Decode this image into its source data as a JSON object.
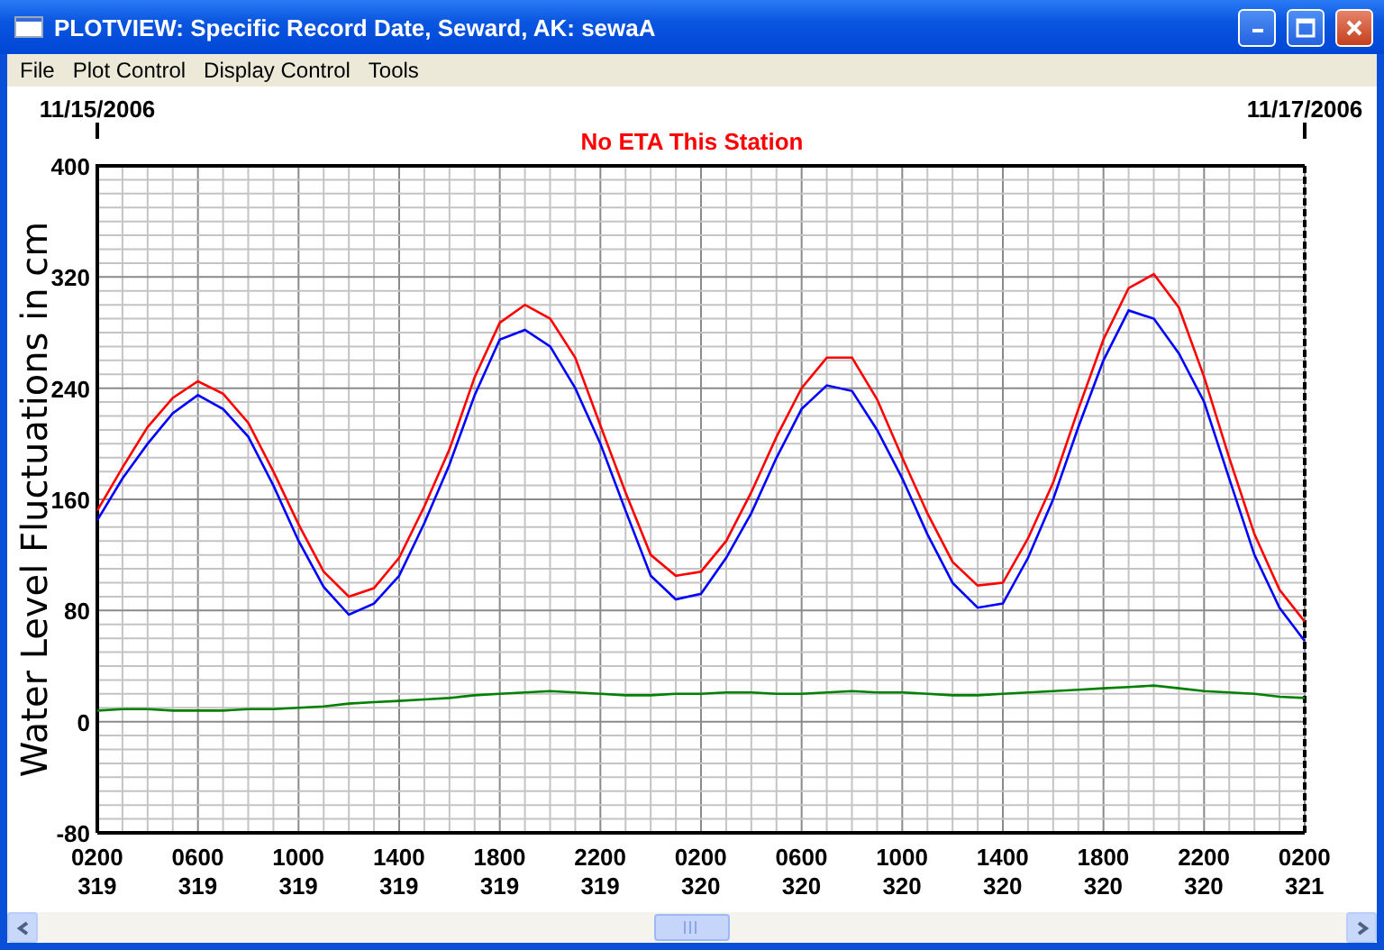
{
  "window": {
    "title": "PLOTVIEW: Specific Record Date, Seward, AK: sewaA"
  },
  "menu": [
    "File",
    "Plot Control",
    "Display Control",
    "Tools"
  ],
  "plot": {
    "date_labels": [
      "11/15/2006",
      "11/17/2006"
    ],
    "chart_data": {
      "type": "line",
      "title": "No ETA This Station",
      "ylabel": "Water Level Fluctuations in cm",
      "grid": true,
      "categories": [
        "0200",
        null,
        null,
        null,
        "0600",
        null,
        null,
        null,
        "1000",
        null,
        null,
        null,
        "1400",
        null,
        null,
        null,
        "1800",
        null,
        null,
        null,
        "2200",
        null,
        null,
        null,
        "0200",
        null,
        null,
        null,
        "0600",
        null,
        null,
        null,
        "1000",
        null,
        null,
        null,
        "1400",
        null,
        null,
        null,
        "1800",
        null,
        null,
        null,
        "2200",
        null,
        null,
        null,
        "0200"
      ],
      "series": [
        {
          "color": "#ff0000",
          "values": [
            152,
            183,
            212,
            233,
            245,
            236,
            215,
            180,
            142,
            108,
            90,
            96,
            118,
            155,
            196,
            248,
            287,
            300,
            290,
            262,
            213,
            165,
            120,
            105,
            108,
            130,
            165,
            205,
            240,
            262,
            262,
            232,
            190,
            150,
            115,
            98,
            100,
            132,
            172,
            225,
            275,
            312,
            322,
            298,
            248,
            190,
            135,
            95,
            72
          ]
        },
        {
          "color": "#0000ff",
          "values": [
            145,
            175,
            200,
            222,
            235,
            225,
            205,
            170,
            130,
            97,
            77,
            85,
            105,
            143,
            185,
            235,
            275,
            282,
            270,
            240,
            200,
            152,
            105,
            88,
            92,
            118,
            150,
            190,
            225,
            242,
            238,
            210,
            175,
            135,
            100,
            82,
            85,
            118,
            160,
            212,
            260,
            296,
            290,
            265,
            230,
            175,
            120,
            82,
            58
          ]
        },
        {
          "color": "#008000",
          "values": [
            8,
            9,
            9,
            8,
            8,
            8,
            9,
            9,
            10,
            11,
            13,
            14,
            15,
            16,
            17,
            19,
            20,
            21,
            22,
            21,
            20,
            19,
            19,
            20,
            20,
            21,
            21,
            20,
            20,
            21,
            22,
            21,
            21,
            20,
            19,
            19,
            20,
            21,
            22,
            23,
            24,
            25,
            26,
            24,
            22,
            21,
            20,
            18,
            17
          ]
        }
      ],
      "ylim": [
        -80,
        400
      ],
      "yticks": [
        {
          "value": 400,
          "label": "400"
        },
        {
          "value": 320,
          "label": "320"
        },
        {
          "value": 240,
          "label": "240"
        },
        {
          "value": 160,
          "label": "160"
        },
        {
          "value": 80,
          "label": "80"
        },
        {
          "value": 0,
          "label": "0"
        },
        {
          "value": -80,
          "label": "-80"
        }
      ]
    },
    "day_labels": [
      "319",
      "319",
      "319",
      "319",
      "319",
      "319",
      "320",
      "320",
      "320",
      "320",
      "320",
      "320",
      "321"
    ]
  }
}
